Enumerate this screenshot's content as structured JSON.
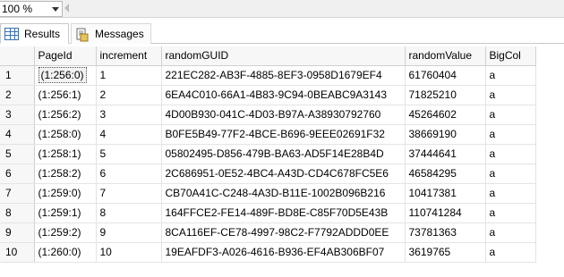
{
  "zoom": {
    "value": "100 %"
  },
  "tabs": {
    "results_label": "Results",
    "messages_label": "Messages"
  },
  "grid": {
    "columns": [
      "PageId",
      "increment",
      "randomGUID",
      "randomValue",
      "BigCol"
    ],
    "rows": [
      {
        "num": "1",
        "pageid": "(1:256:0)",
        "increment": "1",
        "guid": "221EC282-AB3F-4885-8EF3-0958D1679EF4",
        "value": "61760404",
        "big": "a"
      },
      {
        "num": "2",
        "pageid": "(1:256:1)",
        "increment": "2",
        "guid": "6EA4C010-66A1-4B83-9C94-0BEABC9A3143",
        "value": "71825210",
        "big": "a"
      },
      {
        "num": "3",
        "pageid": "(1:256:2)",
        "increment": "3",
        "guid": "4D00B930-041C-4D03-B97A-A38930792760",
        "value": "45264602",
        "big": "a"
      },
      {
        "num": "4",
        "pageid": "(1:258:0)",
        "increment": "4",
        "guid": "B0FE5B49-77F2-4BCE-B696-9EEE02691F32",
        "value": "38669190",
        "big": "a"
      },
      {
        "num": "5",
        "pageid": "(1:258:1)",
        "increment": "5",
        "guid": "05802495-D856-479B-BA63-AD5F14E28B4D",
        "value": "37444641",
        "big": "a"
      },
      {
        "num": "6",
        "pageid": "(1:258:2)",
        "increment": "6",
        "guid": "2C686951-0E52-4BC4-A43D-CD4C678FC5E6",
        "value": "46584295",
        "big": "a"
      },
      {
        "num": "7",
        "pageid": "(1:259:0)",
        "increment": "7",
        "guid": "CB70A41C-C248-4A3D-B11E-1002B096B216",
        "value": "10417381",
        "big": "a"
      },
      {
        "num": "8",
        "pageid": "(1:259:1)",
        "increment": "8",
        "guid": "164FFCE2-FE14-489F-BD8E-C85F70D5E43B",
        "value": "110741284",
        "big": "a"
      },
      {
        "num": "9",
        "pageid": "(1:259:2)",
        "increment": "9",
        "guid": "8CA116EF-CE78-4997-98C2-F7792ADDD0EE",
        "value": "73781363",
        "big": "a"
      },
      {
        "num": "10",
        "pageid": "(1:260:0)",
        "increment": "10",
        "guid": "19EAFDF3-A026-4616-B936-EF4AB306BF07",
        "value": "3619765",
        "big": "a"
      }
    ]
  }
}
